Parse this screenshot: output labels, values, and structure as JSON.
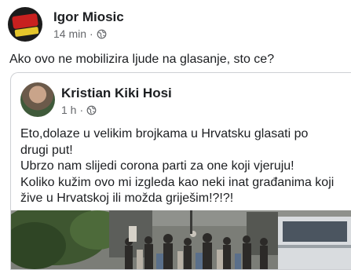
{
  "post": {
    "author": "Igor Miosic",
    "time": "14 min",
    "separator": "·",
    "text": "Ako ovo ne mobilizira ljude na glasanje, sto ce?",
    "avatar_icon": "page-logo-icon",
    "privacy_icon": "globe-icon"
  },
  "shared": {
    "author": "Kristian Kiki Hosi",
    "time": "1 h",
    "separator": "·",
    "privacy_icon": "globe-icon",
    "lines": [
      "Eto,dolaze u velikim brojkama u Hrvatsku glasati po",
      "drugi put!",
      "Ubrzo nam slijedi corona parti za one koji vjeruju!",
      "Koliko kužim ovo mi izgleda kao neki inat građanima koji",
      "žive u Hrvatskoj ili možda griješim!?!?!"
    ]
  },
  "colors": {
    "text": "#1c1e21",
    "meta": "#65676b",
    "card_border": "#ced0d4"
  }
}
